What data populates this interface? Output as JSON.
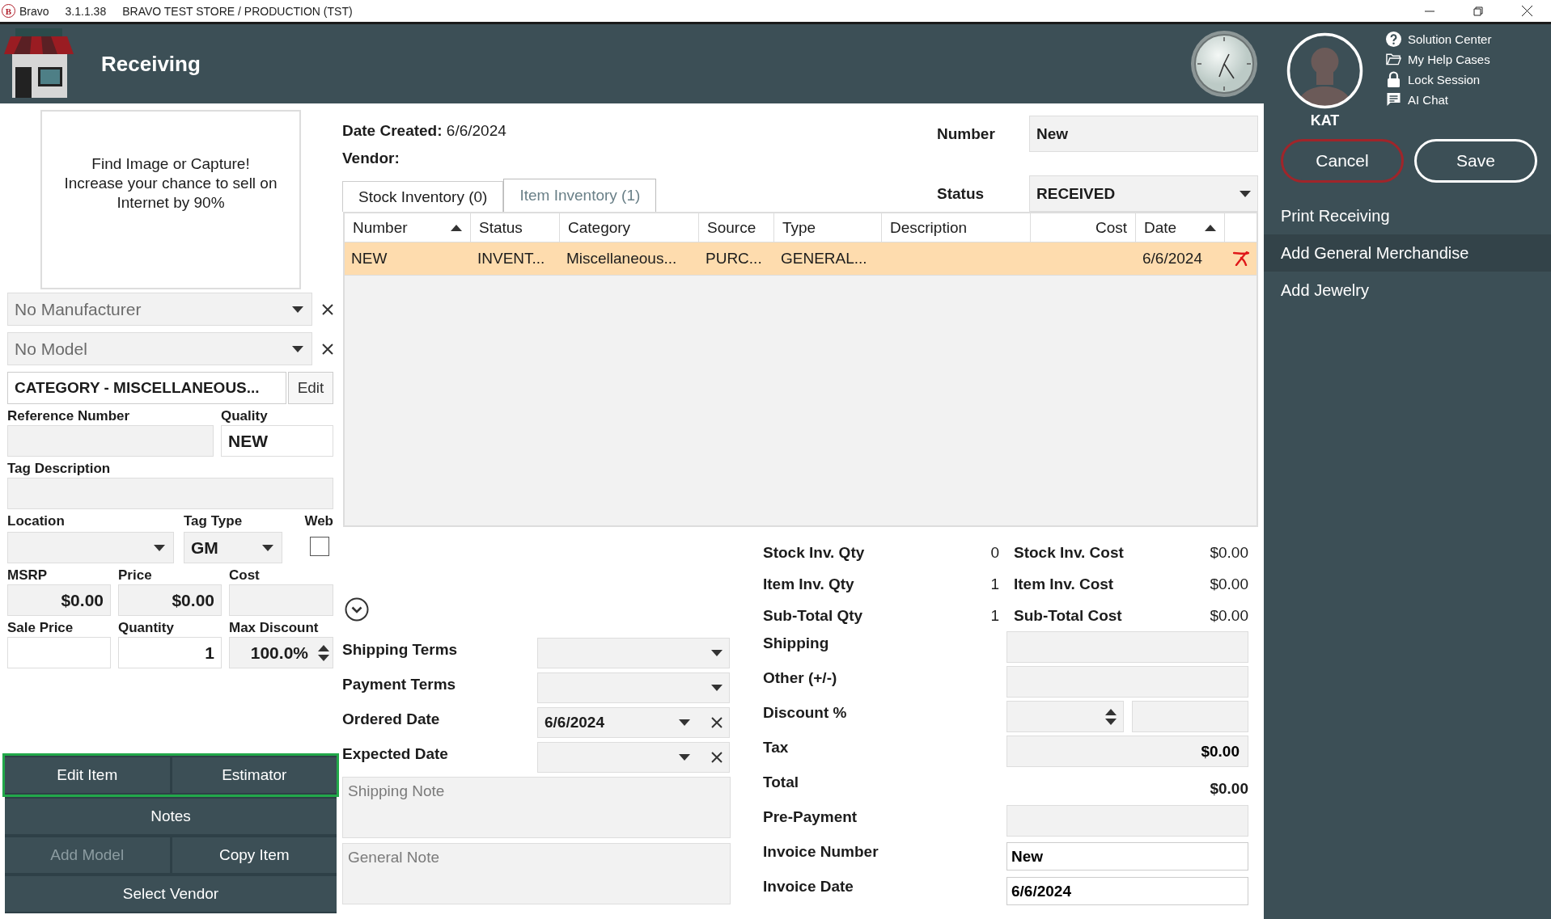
{
  "title_bar": {
    "logo_letter": "B",
    "app_name": "Bravo",
    "version": "3.1.1.38",
    "store": "BRAVO TEST STORE / PRODUCTION (TST)"
  },
  "header": {
    "title": "Receiving"
  },
  "item": {
    "image_prompt": "Find Image or Capture!\nIncrease your chance to sell on\nInternet by 90%",
    "manufacturer": {
      "placeholder": "No Manufacturer"
    },
    "model": {
      "placeholder": "No Model"
    },
    "category": {
      "value": "CATEGORY - MISCELLANEOUS...",
      "button": "Edit"
    },
    "reference_number": {
      "label": "Reference Number"
    },
    "quality": {
      "label": "Quality",
      "value": "NEW"
    },
    "tag_description": {
      "label": "Tag Description"
    },
    "location": {
      "label": "Location"
    },
    "tag_type": {
      "label": "Tag Type",
      "value": "GM"
    },
    "web": {
      "label": "Web",
      "checked": false
    },
    "msrp": {
      "label": "MSRP",
      "value": "$0.00"
    },
    "price": {
      "label": "Price",
      "value": "$0.00"
    },
    "cost": {
      "label": "Cost"
    },
    "sale_price": {
      "label": "Sale Price"
    },
    "quantity": {
      "label": "Quantity",
      "value": "1"
    },
    "max_discount": {
      "label": "Max Discount",
      "value": "100.0%"
    },
    "button_rows": [
      {
        "highlighted": true,
        "buttons": [
          {
            "label": "Edit Item",
            "disabled": false
          },
          {
            "label": "Estimator",
            "disabled": false
          }
        ]
      },
      {
        "highlighted": false,
        "buttons": [
          {
            "label": "Notes",
            "disabled": false
          }
        ]
      },
      {
        "highlighted": false,
        "buttons": [
          {
            "label": "Add Model",
            "disabled": true
          },
          {
            "label": "Copy Item",
            "disabled": false
          }
        ]
      },
      {
        "highlighted": false,
        "buttons": [
          {
            "label": "Select Vendor",
            "disabled": false
          }
        ]
      }
    ]
  },
  "receiving": {
    "date_created_label": "Date Created:",
    "date_created": "6/6/2024",
    "vendor_label": "Vendor:",
    "number": {
      "label": "Number",
      "value": "New"
    },
    "status": {
      "label": "Status",
      "value": "RECEIVED"
    },
    "tabs": [
      {
        "label": "Stock Inventory (0)",
        "selected": false
      },
      {
        "label": "Item Inventory (1)",
        "selected": true
      }
    ],
    "table": {
      "columns": [
        {
          "label": "Number",
          "sorted": true
        },
        {
          "label": "Status",
          "sorted": false
        },
        {
          "label": "Category",
          "sorted": false
        },
        {
          "label": "Source",
          "sorted": false
        },
        {
          "label": "Type",
          "sorted": false
        },
        {
          "label": "Description",
          "sorted": false
        },
        {
          "label": "Cost",
          "sorted": false
        },
        {
          "label": "Date",
          "sorted": true
        }
      ],
      "rows": [
        {
          "selected": true,
          "number": "NEW",
          "status": "INVENT...",
          "category": "Miscellaneous...",
          "source": "PURC...",
          "type": "GENERAL...",
          "date": "6/6/2024"
        }
      ]
    },
    "terms": [
      {
        "label": "Shipping Terms",
        "kind": "dropdown"
      },
      {
        "label": "Payment Terms",
        "kind": "dropdown"
      },
      {
        "label": "Ordered Date",
        "kind": "date",
        "value": "6/6/2024"
      },
      {
        "label": "Expected Date",
        "kind": "date"
      }
    ],
    "notes": [
      {
        "placeholder": "Shipping Note"
      },
      {
        "placeholder": "General Note"
      }
    ],
    "quantities": [
      {
        "label": "Stock Inv. Qty",
        "qty": "0",
        "cost_label": "Stock Inv. Cost",
        "cost": "$0.00"
      },
      {
        "label": "Item Inv. Qty",
        "qty": "1",
        "cost_label": "Item Inv. Cost",
        "cost": "$0.00"
      },
      {
        "label": "Sub-Total Qty",
        "qty": "1",
        "cost_label": "Sub-Total Cost",
        "cost": "$0.00"
      }
    ],
    "totals": [
      {
        "label": "Shipping",
        "kind": "field"
      },
      {
        "label": "Other (+/-)",
        "kind": "field"
      },
      {
        "label": "Discount %",
        "kind": "discount"
      },
      {
        "label": "Tax",
        "kind": "field",
        "value": "$0.00"
      },
      {
        "label": "Total",
        "kind": "text",
        "value": "$0.00"
      },
      {
        "label": "Pre-Payment",
        "kind": "field"
      },
      {
        "label": "Invoice Number",
        "kind": "input",
        "value": "New"
      },
      {
        "label": "Invoice Date",
        "kind": "input",
        "value": "6/6/2024"
      }
    ]
  },
  "user": {
    "name": "KAT",
    "links": [
      {
        "label": "Solution Center",
        "kind": "help"
      },
      {
        "label": "My Help Cases",
        "kind": "folder"
      },
      {
        "label": "Lock Session",
        "kind": "lock"
      },
      {
        "label": "AI Chat",
        "kind": "chat"
      }
    ]
  },
  "actions": [
    {
      "label": "Cancel",
      "kind": "cancel"
    },
    {
      "label": "Save",
      "kind": "save"
    }
  ],
  "menu": [
    {
      "label": "Print Receiving",
      "selected": false
    },
    {
      "label": "Add General Merchandise",
      "selected": true
    },
    {
      "label": "Add Jewelry",
      "selected": false
    }
  ]
}
